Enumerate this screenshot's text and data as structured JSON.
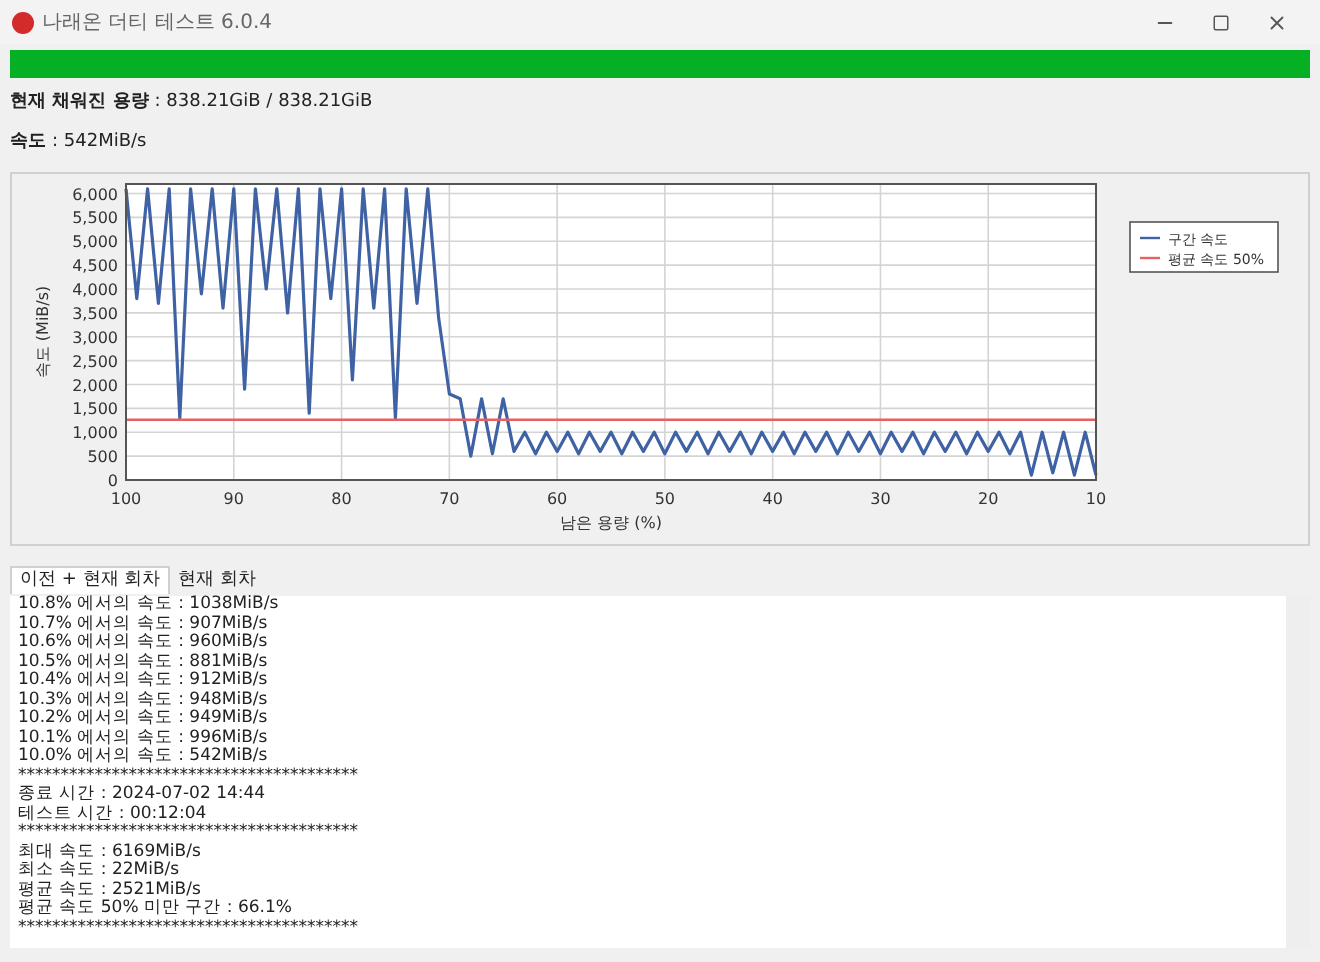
{
  "window": {
    "title": "나래온 더티 테스트 6.0.4"
  },
  "progress": {
    "level": 1
  },
  "status": [
    {
      "label": "현재 채워진 용량",
      "value": ": 838.21GiB / 838.21GiB"
    },
    {
      "label": "속도",
      "value": ": 542MiB/s"
    }
  ],
  "chart": {
    "chart_data": {
      "type": "line",
      "xlabel": "남은 용량 (%)",
      "ylabel": "속도 (MiB/s)",
      "x": [
        100,
        99,
        98,
        97,
        96,
        95,
        94,
        93,
        92,
        91,
        90,
        89,
        88,
        87,
        86,
        85,
        84,
        83,
        82,
        81,
        80,
        79,
        78,
        77,
        76,
        75,
        74,
        73,
        72,
        71,
        70,
        69,
        68,
        67,
        66,
        65,
        64,
        63,
        62,
        61,
        60,
        59,
        58,
        57,
        56,
        55,
        54,
        53,
        52,
        51,
        50,
        49,
        48,
        47,
        46,
        45,
        44,
        43,
        42,
        41,
        40,
        39,
        38,
        37,
        36,
        35,
        34,
        33,
        32,
        31,
        30,
        29,
        28,
        27,
        26,
        25,
        24,
        23,
        22,
        21,
        20,
        19,
        18,
        17,
        16,
        15,
        14,
        13,
        12,
        11,
        10
      ],
      "series": [
        {
          "name": "구간 속도",
          "color": "#3f62a4",
          "values": [
            6100,
            3800,
            6100,
            3700,
            6100,
            1300,
            6100,
            3900,
            6100,
            3600,
            6100,
            1900,
            6100,
            4000,
            6100,
            3500,
            6100,
            1400,
            6100,
            3800,
            6100,
            2100,
            6100,
            3600,
            6100,
            1300,
            6100,
            3700,
            6100,
            3400,
            1800,
            1700,
            500,
            1700,
            550,
            1700,
            600,
            1000,
            550,
            1000,
            600,
            1000,
            550,
            1000,
            600,
            1000,
            550,
            1000,
            600,
            1000,
            550,
            1000,
            600,
            1000,
            550,
            1000,
            600,
            1000,
            550,
            1000,
            600,
            1000,
            550,
            1000,
            600,
            1000,
            550,
            1000,
            600,
            1000,
            550,
            1000,
            600,
            1000,
            550,
            1000,
            600,
            1000,
            550,
            1000,
            600,
            1000,
            550,
            1000,
            100,
            1000,
            150,
            1000,
            100,
            1000,
            100
          ]
        },
        {
          "name": "평균 속도 50%",
          "color": "#e86060",
          "values": [
            1260,
            1260,
            1260,
            1260,
            1260,
            1260,
            1260,
            1260,
            1260,
            1260,
            1260,
            1260,
            1260,
            1260,
            1260,
            1260,
            1260,
            1260,
            1260,
            1260,
            1260,
            1260,
            1260,
            1260,
            1260,
            1260,
            1260,
            1260,
            1260,
            1260,
            1260,
            1260,
            1260,
            1260,
            1260,
            1260,
            1260,
            1260,
            1260,
            1260,
            1260,
            1260,
            1260,
            1260,
            1260,
            1260,
            1260,
            1260,
            1260,
            1260,
            1260,
            1260,
            1260,
            1260,
            1260,
            1260,
            1260,
            1260,
            1260,
            1260,
            1260,
            1260,
            1260,
            1260,
            1260,
            1260,
            1260,
            1260,
            1260,
            1260,
            1260,
            1260,
            1260,
            1260,
            1260,
            1260,
            1260,
            1260,
            1260,
            1260,
            1260,
            1260,
            1260,
            1260,
            1260,
            1260,
            1260,
            1260,
            1260,
            1260,
            1260
          ]
        }
      ],
      "xlim": [
        100,
        10
      ],
      "ylim": [
        0,
        6200
      ],
      "grid": true,
      "legend": true,
      "xticks": [
        100,
        90,
        80,
        70,
        60,
        50,
        40,
        30,
        20,
        10
      ],
      "yticks": [
        {
          "value": 0,
          "label": "0"
        },
        {
          "value": 500,
          "label": "500"
        },
        {
          "value": 1000,
          "label": "1,000"
        },
        {
          "value": 1500,
          "label": "1,500"
        },
        {
          "value": 2000,
          "label": "2,000"
        },
        {
          "value": 2500,
          "label": "2,500"
        },
        {
          "value": 3000,
          "label": "3,000"
        },
        {
          "value": 3500,
          "label": "3,500"
        },
        {
          "value": 4000,
          "label": "4,000"
        },
        {
          "value": 4500,
          "label": "4,500"
        },
        {
          "value": 5000,
          "label": "5,000"
        },
        {
          "value": 5500,
          "label": "5,500"
        },
        {
          "value": 6000,
          "label": "6,000"
        }
      ]
    }
  },
  "tabs": [
    {
      "label": "이전 + 현재 회차",
      "selected": true
    },
    {
      "label": "현재 회차",
      "selected": false
    }
  ],
  "log_lines": [
    "10.8% 에서의 속도 : 1038MiB/s",
    "10.7% 에서의 속도 : 907MiB/s",
    "10.6% 에서의 속도 : 960MiB/s",
    "10.5% 에서의 속도 : 881MiB/s",
    "10.4% 에서의 속도 : 912MiB/s",
    "10.3% 에서의 속도 : 948MiB/s",
    "10.2% 에서의 속도 : 949MiB/s",
    "10.1% 에서의 속도 : 996MiB/s",
    "10.0% 에서의 속도 : 542MiB/s",
    "****************************************",
    "종료 시간 : 2024-07-02 14:44",
    "테스트 시간 : 00:12:04",
    "****************************************",
    "최대 속도 : 6169MiB/s",
    "최소 속도 : 22MiB/s",
    "평균 속도 : 2521MiB/s",
    "평균 속도 50% 미만 구간 : 66.1%",
    "****************************************"
  ]
}
